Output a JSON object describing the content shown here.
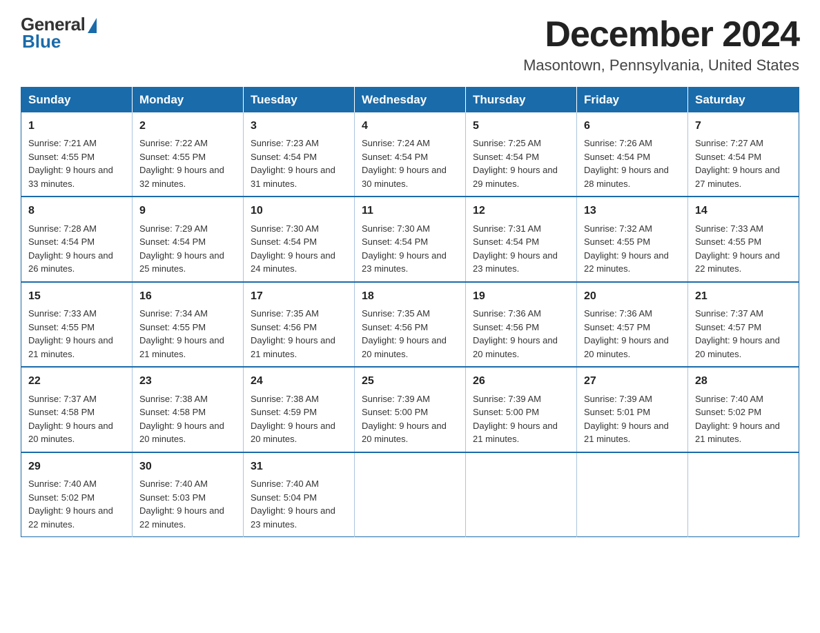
{
  "logo": {
    "general": "General",
    "blue": "Blue"
  },
  "header": {
    "month": "December 2024",
    "location": "Masontown, Pennsylvania, United States"
  },
  "weekdays": [
    "Sunday",
    "Monday",
    "Tuesday",
    "Wednesday",
    "Thursday",
    "Friday",
    "Saturday"
  ],
  "weeks": [
    [
      {
        "day": "1",
        "sunrise": "7:21 AM",
        "sunset": "4:55 PM",
        "daylight": "9 hours and 33 minutes."
      },
      {
        "day": "2",
        "sunrise": "7:22 AM",
        "sunset": "4:55 PM",
        "daylight": "9 hours and 32 minutes."
      },
      {
        "day": "3",
        "sunrise": "7:23 AM",
        "sunset": "4:54 PM",
        "daylight": "9 hours and 31 minutes."
      },
      {
        "day": "4",
        "sunrise": "7:24 AM",
        "sunset": "4:54 PM",
        "daylight": "9 hours and 30 minutes."
      },
      {
        "day": "5",
        "sunrise": "7:25 AM",
        "sunset": "4:54 PM",
        "daylight": "9 hours and 29 minutes."
      },
      {
        "day": "6",
        "sunrise": "7:26 AM",
        "sunset": "4:54 PM",
        "daylight": "9 hours and 28 minutes."
      },
      {
        "day": "7",
        "sunrise": "7:27 AM",
        "sunset": "4:54 PM",
        "daylight": "9 hours and 27 minutes."
      }
    ],
    [
      {
        "day": "8",
        "sunrise": "7:28 AM",
        "sunset": "4:54 PM",
        "daylight": "9 hours and 26 minutes."
      },
      {
        "day": "9",
        "sunrise": "7:29 AM",
        "sunset": "4:54 PM",
        "daylight": "9 hours and 25 minutes."
      },
      {
        "day": "10",
        "sunrise": "7:30 AM",
        "sunset": "4:54 PM",
        "daylight": "9 hours and 24 minutes."
      },
      {
        "day": "11",
        "sunrise": "7:30 AM",
        "sunset": "4:54 PM",
        "daylight": "9 hours and 23 minutes."
      },
      {
        "day": "12",
        "sunrise": "7:31 AM",
        "sunset": "4:54 PM",
        "daylight": "9 hours and 23 minutes."
      },
      {
        "day": "13",
        "sunrise": "7:32 AM",
        "sunset": "4:55 PM",
        "daylight": "9 hours and 22 minutes."
      },
      {
        "day": "14",
        "sunrise": "7:33 AM",
        "sunset": "4:55 PM",
        "daylight": "9 hours and 22 minutes."
      }
    ],
    [
      {
        "day": "15",
        "sunrise": "7:33 AM",
        "sunset": "4:55 PM",
        "daylight": "9 hours and 21 minutes."
      },
      {
        "day": "16",
        "sunrise": "7:34 AM",
        "sunset": "4:55 PM",
        "daylight": "9 hours and 21 minutes."
      },
      {
        "day": "17",
        "sunrise": "7:35 AM",
        "sunset": "4:56 PM",
        "daylight": "9 hours and 21 minutes."
      },
      {
        "day": "18",
        "sunrise": "7:35 AM",
        "sunset": "4:56 PM",
        "daylight": "9 hours and 20 minutes."
      },
      {
        "day": "19",
        "sunrise": "7:36 AM",
        "sunset": "4:56 PM",
        "daylight": "9 hours and 20 minutes."
      },
      {
        "day": "20",
        "sunrise": "7:36 AM",
        "sunset": "4:57 PM",
        "daylight": "9 hours and 20 minutes."
      },
      {
        "day": "21",
        "sunrise": "7:37 AM",
        "sunset": "4:57 PM",
        "daylight": "9 hours and 20 minutes."
      }
    ],
    [
      {
        "day": "22",
        "sunrise": "7:37 AM",
        "sunset": "4:58 PM",
        "daylight": "9 hours and 20 minutes."
      },
      {
        "day": "23",
        "sunrise": "7:38 AM",
        "sunset": "4:58 PM",
        "daylight": "9 hours and 20 minutes."
      },
      {
        "day": "24",
        "sunrise": "7:38 AM",
        "sunset": "4:59 PM",
        "daylight": "9 hours and 20 minutes."
      },
      {
        "day": "25",
        "sunrise": "7:39 AM",
        "sunset": "5:00 PM",
        "daylight": "9 hours and 20 minutes."
      },
      {
        "day": "26",
        "sunrise": "7:39 AM",
        "sunset": "5:00 PM",
        "daylight": "9 hours and 21 minutes."
      },
      {
        "day": "27",
        "sunrise": "7:39 AM",
        "sunset": "5:01 PM",
        "daylight": "9 hours and 21 minutes."
      },
      {
        "day": "28",
        "sunrise": "7:40 AM",
        "sunset": "5:02 PM",
        "daylight": "9 hours and 21 minutes."
      }
    ],
    [
      {
        "day": "29",
        "sunrise": "7:40 AM",
        "sunset": "5:02 PM",
        "daylight": "9 hours and 22 minutes."
      },
      {
        "day": "30",
        "sunrise": "7:40 AM",
        "sunset": "5:03 PM",
        "daylight": "9 hours and 22 minutes."
      },
      {
        "day": "31",
        "sunrise": "7:40 AM",
        "sunset": "5:04 PM",
        "daylight": "9 hours and 23 minutes."
      },
      null,
      null,
      null,
      null
    ]
  ]
}
